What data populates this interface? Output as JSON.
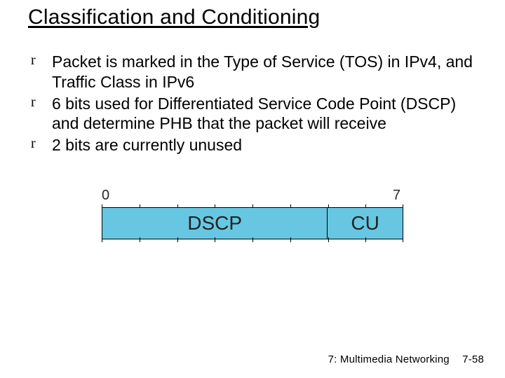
{
  "title": "Classification and Conditioning",
  "bullets": [
    "Packet is marked in the Type of Service (TOS) in IPv4, and Traffic Class in IPv6",
    "6 bits used for Differentiated Service Code Point (DSCP) and determine PHB that the packet will receive",
    "2 bits are currently unused"
  ],
  "diagram": {
    "left_tick": "0",
    "right_tick": "7",
    "fields": {
      "dscp": "DSCP",
      "cu": "CU"
    },
    "bit_count": 8
  },
  "footer": {
    "chapter": "7: Multimedia Networking",
    "page": "7-58"
  }
}
